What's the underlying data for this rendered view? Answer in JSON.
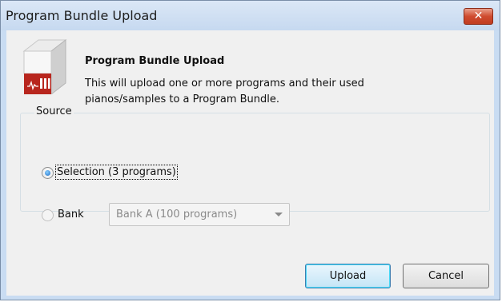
{
  "window": {
    "title": "Program Bundle Upload",
    "close_glyph": "✕"
  },
  "header": {
    "icon": "piano-samples-box-icon",
    "title": "Program Bundle Upload",
    "description": "This will upload one or more programs and their used pianos/samples to a Program Bundle."
  },
  "source": {
    "legend": "Source",
    "options": [
      {
        "label": "Selection (3 programs)",
        "checked": true,
        "enabled": true
      },
      {
        "label": "Bank",
        "checked": false,
        "enabled": false
      }
    ],
    "bank_select": {
      "value": "Bank A (100 programs)",
      "enabled": false
    }
  },
  "buttons": {
    "upload": "Upload",
    "cancel": "Cancel"
  },
  "colors": {
    "title_bar": "#c9dcf2",
    "close_button": "#c9452a",
    "icon_red": "#b8261e",
    "focus_blue": "#3c7fb1"
  }
}
